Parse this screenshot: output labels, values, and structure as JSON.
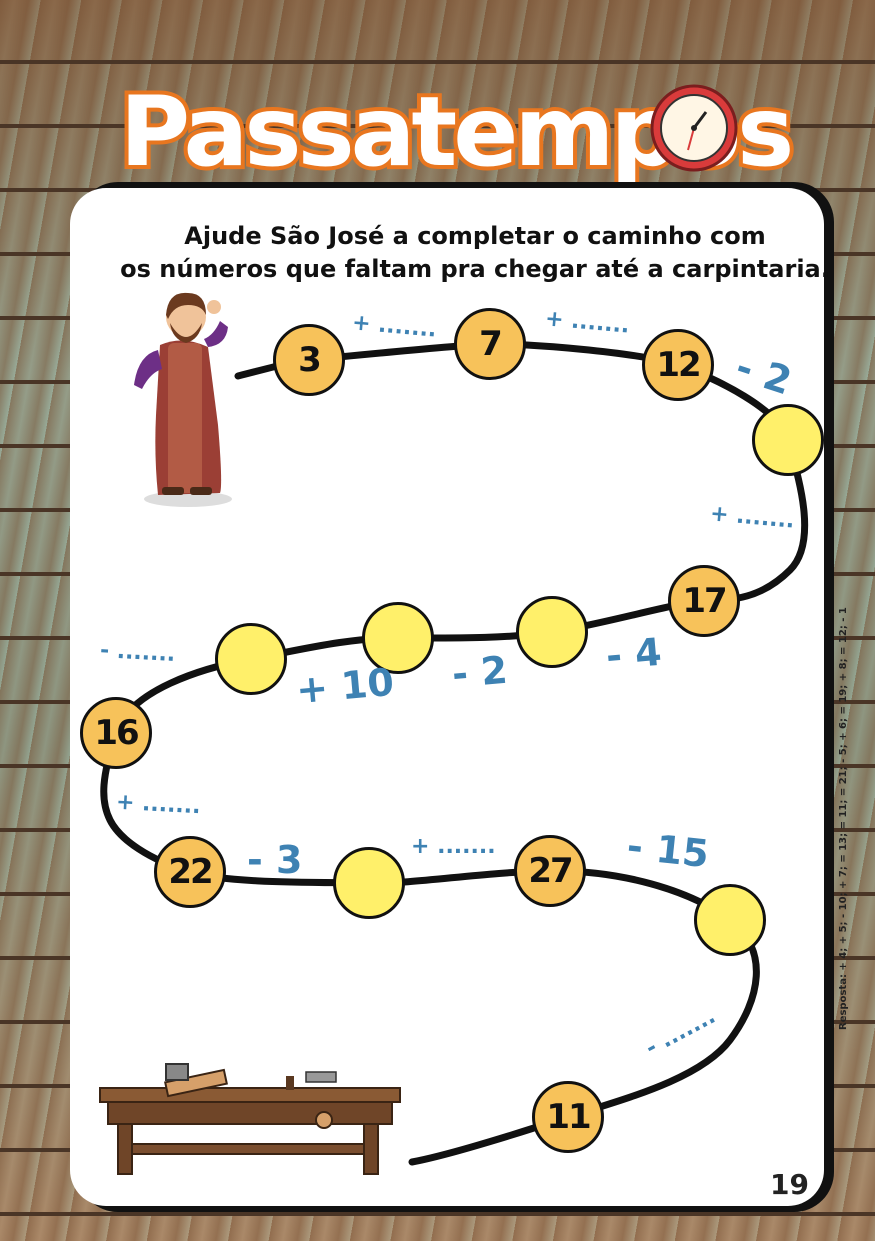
{
  "title": "Passatempos",
  "instructions": {
    "line1": "Ajude São José a completar o caminho com",
    "line2": "os números que faltam pra chegar até a carpintaria."
  },
  "nodes": [
    {
      "id": "n1",
      "value": "3"
    },
    {
      "id": "n2",
      "value": "7"
    },
    {
      "id": "n3",
      "value": "12"
    },
    {
      "id": "n4",
      "value": ""
    },
    {
      "id": "n5",
      "value": "17"
    },
    {
      "id": "n6",
      "value": ""
    },
    {
      "id": "n7",
      "value": ""
    },
    {
      "id": "n8",
      "value": ""
    },
    {
      "id": "n9",
      "value": "16"
    },
    {
      "id": "n10",
      "value": "22"
    },
    {
      "id": "n11",
      "value": ""
    },
    {
      "id": "n12",
      "value": "27"
    },
    {
      "id": "n13",
      "value": ""
    },
    {
      "id": "n14",
      "value": "11"
    }
  ],
  "operations": [
    {
      "id": "op1",
      "text": "+ ......."
    },
    {
      "id": "op2",
      "text": "+ ......."
    },
    {
      "id": "op3",
      "text": "- 2"
    },
    {
      "id": "op4",
      "text": "+ ......."
    },
    {
      "id": "op5",
      "text": "- 4"
    },
    {
      "id": "op6",
      "text": "- 2"
    },
    {
      "id": "op7",
      "text": "+ 10"
    },
    {
      "id": "op8",
      "text": "- ......."
    },
    {
      "id": "op9",
      "text": "+ ......."
    },
    {
      "id": "op10",
      "text": "- 3"
    },
    {
      "id": "op11",
      "text": "+ ......."
    },
    {
      "id": "op12",
      "text": "- 15"
    },
    {
      "id": "op13",
      "text": "- ......."
    }
  ],
  "answer": "Resposta: + 4; + 5; - 10; + 7; = 13; = 11; = 21; - 5; + 6; = 19; + 8; = 12; - 1",
  "page_number": "19",
  "colors": {
    "node_filled": "#f7c25a",
    "node_empty": "#fff06a",
    "operation": "#3e82b3",
    "title_fill": "#ffffff",
    "title_outline": "#e8761f"
  }
}
